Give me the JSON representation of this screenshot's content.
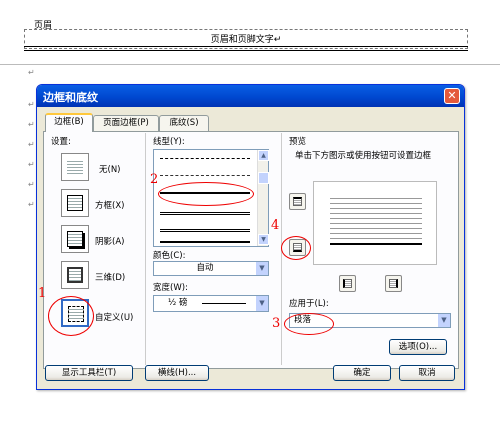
{
  "document": {
    "header_label": "页眉",
    "header_text": "页眉和页脚文字↵",
    "paragraph_mark": "↵"
  },
  "dialog": {
    "title": "边框和底纹",
    "tabs": [
      {
        "label": "边框(B)"
      },
      {
        "label": "页面边框(P)"
      },
      {
        "label": "底纹(S)"
      }
    ],
    "settings_label": "设置:",
    "presets": [
      {
        "label": "无(N)"
      },
      {
        "label": "方框(X)"
      },
      {
        "label": "阴影(A)"
      },
      {
        "label": "三维(D)"
      },
      {
        "label": "自定义(U)"
      }
    ],
    "line_style_label": "线型(Y):",
    "color_label": "颜色(C):",
    "color_value": "自动",
    "width_label": "宽度(W):",
    "width_value": "½ 磅",
    "preview_label": "预览",
    "preview_hint": "单击下方图示或使用按钮可设置边框",
    "apply_label": "应用于(L):",
    "apply_value": "段落",
    "options_button": "选项(O)...",
    "toolbar_button": "显示工具栏(T)",
    "hline_button": "横线(H)...",
    "ok_button": "确定",
    "cancel_button": "取消"
  },
  "annotations": {
    "numbers": [
      "1",
      "2",
      "3",
      "4"
    ],
    "color": "#e00000"
  },
  "colors": {
    "titlebar": "#0048d0",
    "dialog_bg": "#ece9d8",
    "active_tab_highlight": "#ffc83c"
  }
}
